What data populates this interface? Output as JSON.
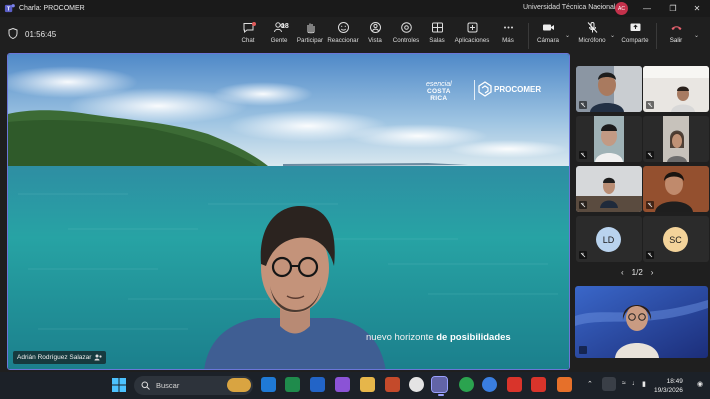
{
  "window": {
    "title": "Charla: PROCOMER",
    "organization": "Universidad Técnica Nacional",
    "account_initials": "AC",
    "more_label": "···"
  },
  "toolbar": {
    "timer": "01:56:45",
    "people_count": "18",
    "buttons": [
      {
        "label": "Chat",
        "icon": "chat-icon"
      },
      {
        "label": "Gente",
        "icon": "people-icon"
      },
      {
        "label": "Participar",
        "icon": "raise-hand-icon"
      },
      {
        "label": "Reaccionar",
        "icon": "smiley-icon"
      },
      {
        "label": "Vista",
        "icon": "view-icon"
      },
      {
        "label": "Controles",
        "icon": "controls-icon"
      },
      {
        "label": "Salas",
        "icon": "rooms-icon"
      },
      {
        "label": "Aplicaciones",
        "icon": "apps-icon"
      },
      {
        "label": "Más",
        "icon": "more-icon"
      }
    ],
    "camera_label": "Cámara",
    "mic_label": "Micrófono",
    "share_label": "Comparte",
    "leave_label": "Salir"
  },
  "stage": {
    "logo_brand_line1": "esencial",
    "logo_brand_line2": "COSTA",
    "logo_brand_line3": "RICA",
    "logo_company": "PROCOMER",
    "tagline_light": "nuevo horizonte",
    "tagline_mid": "de",
    "tagline_bold": "posibilidades",
    "presenter_name": "Adrián Rodríguez Salazar"
  },
  "participants": {
    "initials": [
      "LD",
      "SC"
    ],
    "initials_colors": [
      "#b9d3ee",
      "#f3d39a"
    ],
    "pager": "1/2"
  },
  "taskbar": {
    "search_placeholder": "Buscar",
    "time": "18:49",
    "date": "19/3/2026"
  },
  "colors": {
    "accent": "#6b76d8",
    "leave": "#c4314b"
  }
}
